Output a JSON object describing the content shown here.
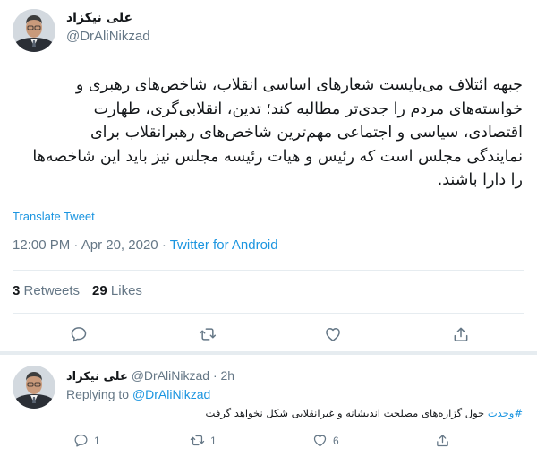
{
  "main_tweet": {
    "display_name": "علی نیکزاد",
    "handle": "@DrAliNikzad",
    "text_lines": [
      "جبهه ائتلاف می‌بایست شعارهای اساسی انقلاب، شاخص‌های رهبری و",
      "خواسته‌های مردم را جدی‌تر مطالبه کند؛ تدین، انقلابی‌گری، طهارت",
      "اقتصادی، سیاسی و اجتماعی مهم‌ترین شاخص‌های رهبرانقلاب برای",
      "نمایندگی مجلس است که رئیس و هیات رئیسه مجلس نیز باید این شاخصه‌ها",
      "را دارا باشند."
    ],
    "translate_label": "Translate Tweet",
    "time": "12:00 PM",
    "date": "Apr 20, 2020",
    "source": "Twitter for Android",
    "retweets_count": "3",
    "retweets_label": "Retweets",
    "likes_count": "29",
    "likes_label": "Likes"
  },
  "reply": {
    "display_name": "علی نیکزاد",
    "handle": "@DrAliNikzad",
    "age": "2h",
    "replying_prefix": "Replying to",
    "replying_mention": "@DrAliNikzad",
    "hashtag": "#وحدت",
    "text": "حول گزاره‌های مصلحت اندیشانه و غیرانقلابی شکل نخواهد گرفت",
    "reply_count": "1",
    "retweet_count": "1",
    "like_count": "6"
  },
  "colors": {
    "link_blue": "#1b95e0",
    "secondary_gray": "#657786",
    "divider": "#e6ecf0"
  },
  "icons": [
    "reply-icon",
    "retweet-icon",
    "like-icon",
    "share-icon"
  ]
}
